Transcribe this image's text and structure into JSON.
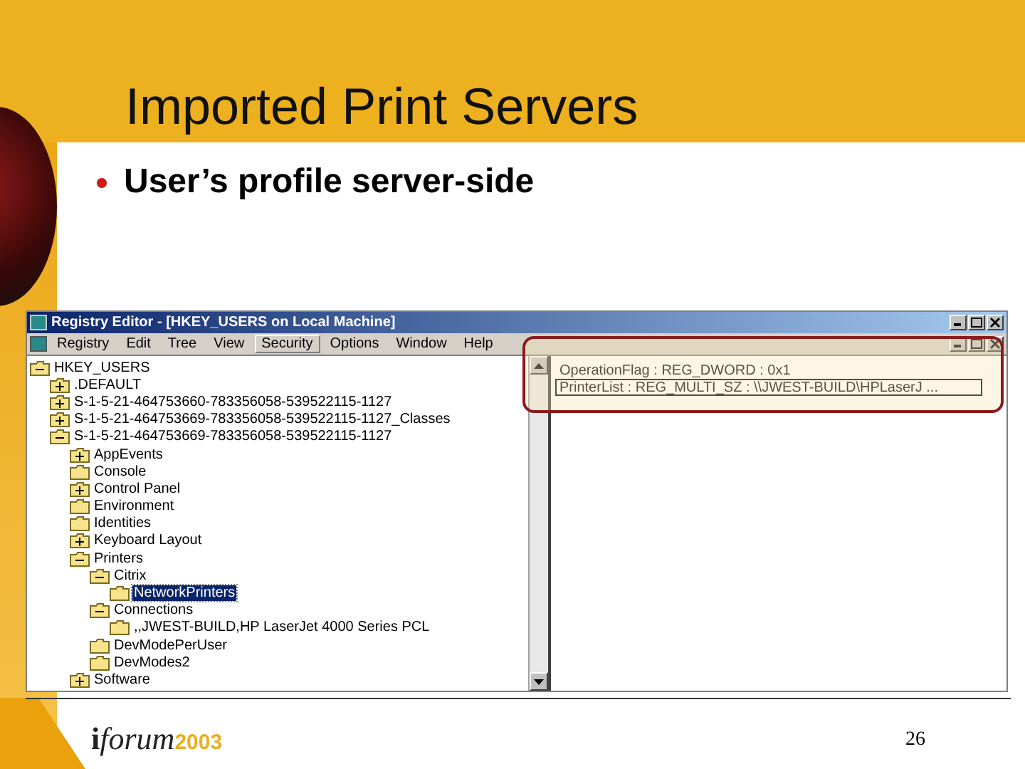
{
  "slide": {
    "title": "Imported Print Servers",
    "bullets": [
      "User’s profile server-side"
    ],
    "page_number": "26",
    "logo": {
      "mark": "i",
      "word": "forum",
      "year": "2003"
    }
  },
  "window": {
    "title": "Registry Editor - [HKEY_USERS on Local Machine]",
    "menu": [
      {
        "label": "Registry",
        "selected": false
      },
      {
        "label": "Edit",
        "selected": false
      },
      {
        "label": "Tree",
        "selected": false
      },
      {
        "label": "View",
        "selected": false
      },
      {
        "label": "Security",
        "selected": true
      },
      {
        "label": "Options",
        "selected": false
      },
      {
        "label": "Window",
        "selected": false
      },
      {
        "label": "Help",
        "selected": false
      }
    ],
    "tree": [
      {
        "label": "HKEY_USERS",
        "expanded": true,
        "selected": false,
        "children": [
          {
            "label": ".DEFAULT",
            "expanded": false,
            "selected": false
          },
          {
            "label": "S-1-5-21-464753660-783356058-539522115-1127",
            "expanded": false,
            "selected": false
          },
          {
            "label": "S-1-5-21-464753669-783356058-539522115-1127_Classes",
            "expanded": false,
            "selected": false
          },
          {
            "label": "S-1-5-21-464753669-783356058-539522115-1127",
            "expanded": true,
            "selected": false,
            "children": [
              {
                "label": "AppEvents",
                "expanded": false,
                "selected": false
              },
              {
                "label": "Console",
                "selected": false
              },
              {
                "label": "Control Panel",
                "expanded": false,
                "selected": false
              },
              {
                "label": "Environment",
                "selected": false
              },
              {
                "label": "Identities",
                "selected": false
              },
              {
                "label": "Keyboard Layout",
                "expanded": false,
                "selected": false
              },
              {
                "label": "Printers",
                "expanded": true,
                "selected": false,
                "children": [
                  {
                    "label": "Citrix",
                    "expanded": true,
                    "selected": false,
                    "children": [
                      {
                        "label": "NetworkPrinters",
                        "selected": true
                      }
                    ]
                  },
                  {
                    "label": "Connections",
                    "expanded": true,
                    "selected": false,
                    "children": [
                      {
                        "label": ",,JWEST-BUILD,HP LaserJet 4000 Series PCL",
                        "selected": false
                      }
                    ]
                  },
                  {
                    "label": "DevModePerUser",
                    "selected": false
                  },
                  {
                    "label": "DevModes2",
                    "selected": false
                  }
                ]
              },
              {
                "label": "Software",
                "expanded": false,
                "selected": false
              }
            ]
          }
        ]
      }
    ],
    "values": [
      {
        "text": "OperationFlag : REG_DWORD : 0x1",
        "selected": false
      },
      {
        "text": "PrinterList : REG_MULTI_SZ : \\\\JWEST-BUILD\\HPLaserJ ...",
        "selected": true
      }
    ]
  }
}
